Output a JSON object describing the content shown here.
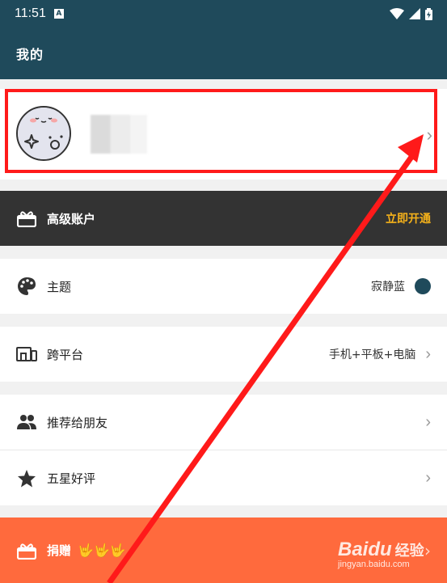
{
  "status_bar": {
    "time": "11:51",
    "notification_badge": "A"
  },
  "app_bar": {
    "title": "我的"
  },
  "profile": {
    "has_avatar": true
  },
  "premium": {
    "label": "高级账户",
    "cta": "立即开通",
    "cta_color": "#f6b21a"
  },
  "settings": {
    "theme": {
      "label": "主题",
      "value": "寂静蓝",
      "swatch_color": "#1f4a5b"
    },
    "cross_platform": {
      "label": "跨平台",
      "value": "手机+平板+电脑"
    },
    "recommend": {
      "label": "推荐给朋友"
    },
    "rate": {
      "label": "五星好评"
    }
  },
  "donate": {
    "label": "捐赠",
    "emoji": "🤟🤟🤟"
  },
  "watermark": {
    "brand": "Baidu",
    "brand_suffix": "经验",
    "url": "jingyan.baidu.com"
  },
  "colors": {
    "primary": "#1f4a5b",
    "premium_bg": "#333333",
    "donate_bg": "#ff6a3d",
    "highlight": "#ff1a1a"
  }
}
